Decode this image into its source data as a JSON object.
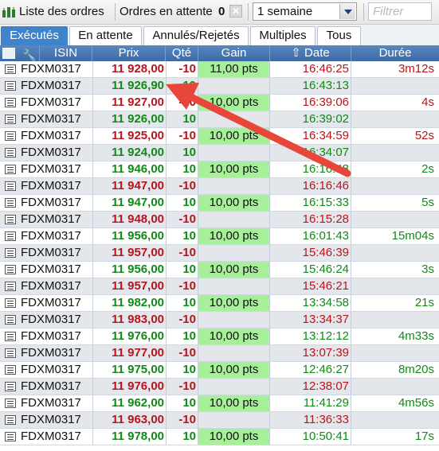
{
  "toolbar": {
    "title": "Liste des ordres",
    "pending_label": "Ordres en attente",
    "pending_count": "0",
    "period_value": "1 semaine",
    "filter_placeholder": "Filtrer"
  },
  "tabs": [
    "Exécutés",
    "En attente",
    "Annulés/Rejetés",
    "Multiples",
    "Tous"
  ],
  "columns": [
    "ISIN",
    "Prix",
    "Qté",
    "Gain",
    "Date",
    "Durée"
  ],
  "rows": [
    {
      "isin": "FDXM0317",
      "prix": "11 928,00",
      "qte": "-10",
      "gain": "11,00 pts",
      "date": "16:46:25",
      "duree": "3m12s",
      "side": "sell"
    },
    {
      "isin": "FDXM0317",
      "prix": "11 926,90",
      "qte": "10",
      "gain": "",
      "date": "16:43:13",
      "duree": "",
      "side": "buy"
    },
    {
      "isin": "FDXM0317",
      "prix": "11 927,00",
      "qte": "-10",
      "gain": "10,00 pts",
      "date": "16:39:06",
      "duree": "4s",
      "side": "sell"
    },
    {
      "isin": "FDXM0317",
      "prix": "11 926,00",
      "qte": "10",
      "gain": "",
      "date": "16:39:02",
      "duree": "",
      "side": "buy"
    },
    {
      "isin": "FDXM0317",
      "prix": "11 925,00",
      "qte": "-10",
      "gain": "10,00 pts",
      "date": "16:34:59",
      "duree": "52s",
      "side": "sell"
    },
    {
      "isin": "FDXM0317",
      "prix": "11 924,00",
      "qte": "10",
      "gain": "",
      "date": "16:34:07",
      "duree": "",
      "side": "buy"
    },
    {
      "isin": "FDXM0317",
      "prix": "11 946,00",
      "qte": "10",
      "gain": "10,00 pts",
      "date": "16:16:48",
      "duree": "2s",
      "side": "buy"
    },
    {
      "isin": "FDXM0317",
      "prix": "11 947,00",
      "qte": "-10",
      "gain": "",
      "date": "16:16:46",
      "duree": "",
      "side": "sell"
    },
    {
      "isin": "FDXM0317",
      "prix": "11 947,00",
      "qte": "10",
      "gain": "10,00 pts",
      "date": "16:15:33",
      "duree": "5s",
      "side": "buy"
    },
    {
      "isin": "FDXM0317",
      "prix": "11 948,00",
      "qte": "-10",
      "gain": "",
      "date": "16:15:28",
      "duree": "",
      "side": "sell"
    },
    {
      "isin": "FDXM0317",
      "prix": "11 956,00",
      "qte": "10",
      "gain": "10,00 pts",
      "date": "16:01:43",
      "duree": "15m04s",
      "side": "buy"
    },
    {
      "isin": "FDXM0317",
      "prix": "11 957,00",
      "qte": "-10",
      "gain": "",
      "date": "15:46:39",
      "duree": "",
      "side": "sell"
    },
    {
      "isin": "FDXM0317",
      "prix": "11 956,00",
      "qte": "10",
      "gain": "10,00 pts",
      "date": "15:46:24",
      "duree": "3s",
      "side": "buy"
    },
    {
      "isin": "FDXM0317",
      "prix": "11 957,00",
      "qte": "-10",
      "gain": "",
      "date": "15:46:21",
      "duree": "",
      "side": "sell"
    },
    {
      "isin": "FDXM0317",
      "prix": "11 982,00",
      "qte": "10",
      "gain": "10,00 pts",
      "date": "13:34:58",
      "duree": "21s",
      "side": "buy"
    },
    {
      "isin": "FDXM0317",
      "prix": "11 983,00",
      "qte": "-10",
      "gain": "",
      "date": "13:34:37",
      "duree": "",
      "side": "sell"
    },
    {
      "isin": "FDXM0317",
      "prix": "11 976,00",
      "qte": "10",
      "gain": "10,00 pts",
      "date": "13:12:12",
      "duree": "4m33s",
      "side": "buy"
    },
    {
      "isin": "FDXM0317",
      "prix": "11 977,00",
      "qte": "-10",
      "gain": "",
      "date": "13:07:39",
      "duree": "",
      "side": "sell"
    },
    {
      "isin": "FDXM0317",
      "prix": "11 975,00",
      "qte": "10",
      "gain": "10,00 pts",
      "date": "12:46:27",
      "duree": "8m20s",
      "side": "buy"
    },
    {
      "isin": "FDXM0317",
      "prix": "11 976,00",
      "qte": "-10",
      "gain": "",
      "date": "12:38:07",
      "duree": "",
      "side": "sell"
    },
    {
      "isin": "FDXM0317",
      "prix": "11 962,00",
      "qte": "10",
      "gain": "10,00 pts",
      "date": "11:41:29",
      "duree": "4m56s",
      "side": "buy"
    },
    {
      "isin": "FDXM0317",
      "prix": "11 963,00",
      "qte": "-10",
      "gain": "",
      "date": "11:36:33",
      "duree": "",
      "side": "sell"
    },
    {
      "isin": "FDXM0317",
      "prix": "11 978,00",
      "qte": "10",
      "gain": "10,00 pts",
      "date": "10:50:41",
      "duree": "17s",
      "side": "buy"
    }
  ],
  "colors": {
    "buy": "#0f8a16",
    "sell": "#b8141b",
    "gain_fill": "#a7f09a",
    "header": "#4a78b3",
    "tab_active": "#3f83cb",
    "annotation_arrow": "#e8463a"
  }
}
